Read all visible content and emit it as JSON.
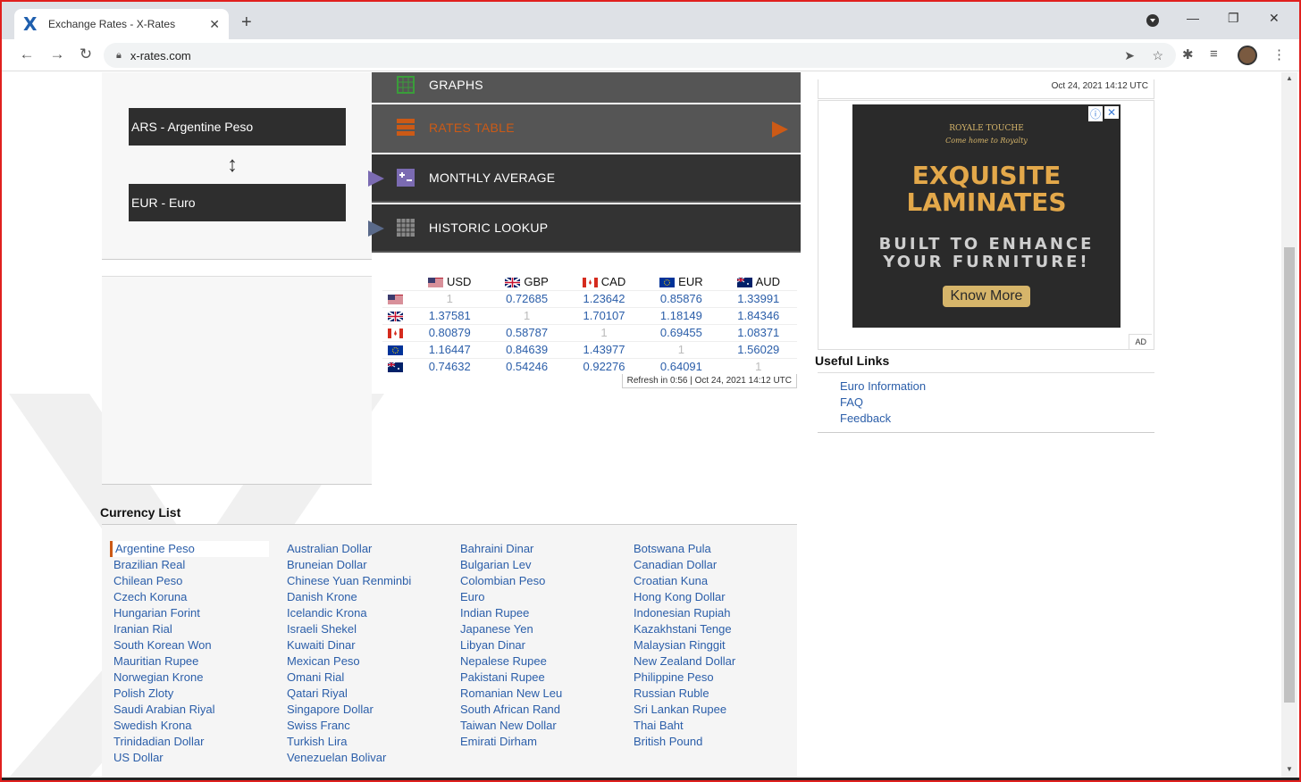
{
  "browser": {
    "tab_title": "Exchange Rates - X-Rates",
    "favicon": "X",
    "url": "x-rates.com"
  },
  "converter": {
    "from_currency": "ARS - Argentine Peso",
    "to_currency": "EUR - Euro"
  },
  "menu": [
    {
      "label": "GRAPHS",
      "active": false
    },
    {
      "label": "RATES TABLE",
      "active": true
    },
    {
      "label": "MONTHLY AVERAGE",
      "active": false
    },
    {
      "label": "HISTORIC LOOKUP",
      "active": false
    }
  ],
  "rates_table": {
    "headers": [
      "USD",
      "GBP",
      "CAD",
      "EUR",
      "AUD"
    ],
    "rows": [
      [
        "1",
        "0.72685",
        "1.23642",
        "0.85876",
        "1.33991"
      ],
      [
        "1.37581",
        "1",
        "1.70107",
        "1.18149",
        "1.84346"
      ],
      [
        "0.80879",
        "0.58787",
        "1",
        "0.69455",
        "1.08371"
      ],
      [
        "1.16447",
        "0.84639",
        "1.43977",
        "1",
        "1.56029"
      ],
      [
        "0.74632",
        "0.54246",
        "0.92276",
        "0.64091",
        "1"
      ]
    ],
    "refresh_text": "Refresh in 0:56 | Oct 24, 2021 14:12 UTC"
  },
  "timestamp": "Oct 24, 2021 14:12 UTC",
  "ad": {
    "brand": "ROYALE TOUCHE",
    "tagline": "Come home to Royalty",
    "headline_1": "EXQUISITE",
    "headline_2": "LAMINATES",
    "sub_1": "BUILT TO ENHANCE",
    "sub_2": "YOUR FURNITURE!",
    "button": "Know More",
    "label": "AD"
  },
  "useful_links": {
    "title": "Useful Links",
    "links": [
      "Euro Information",
      "FAQ",
      "Feedback"
    ]
  },
  "currency_list": {
    "title": "Currency List",
    "columns": [
      [
        "Argentine Peso",
        "Brazilian Real",
        "Chilean Peso",
        "Czech Koruna",
        "Hungarian Forint",
        "Iranian Rial",
        "South Korean Won",
        "Mauritian Rupee",
        "Norwegian Krone",
        "Polish Zloty",
        "Saudi Arabian Riyal",
        "Swedish Krona",
        "Trinidadian Dollar",
        "US Dollar"
      ],
      [
        "Australian Dollar",
        "Bruneian Dollar",
        "Chinese Yuan Renminbi",
        "Danish Krone",
        "Icelandic Krona",
        "Israeli Shekel",
        "Kuwaiti Dinar",
        "Mexican Peso",
        "Omani Rial",
        "Qatari Riyal",
        "Singapore Dollar",
        "Swiss Franc",
        "Turkish Lira",
        "Venezuelan Bolivar"
      ],
      [
        "Bahraini Dinar",
        "Bulgarian Lev",
        "Colombian Peso",
        "Euro",
        "Indian Rupee",
        "Japanese Yen",
        "Libyan Dinar",
        "Nepalese Rupee",
        "Pakistani Rupee",
        "Romanian New Leu",
        "South African Rand",
        "Taiwan New Dollar",
        "Emirati Dirham"
      ],
      [
        "Botswana Pula",
        "Canadian Dollar",
        "Croatian Kuna",
        "Hong Kong Dollar",
        "Indonesian Rupiah",
        "Kazakhstani Tenge",
        "Malaysian Ringgit",
        "New Zealand Dollar",
        "Philippine Peso",
        "Russian Ruble",
        "Sri Lankan Rupee",
        "Thai Baht",
        "British Pound"
      ]
    ],
    "selected": "Argentine Peso"
  },
  "colors": {
    "accent": "#cc5a16",
    "link": "#2b5ea9",
    "menu_bg": "#333333"
  }
}
